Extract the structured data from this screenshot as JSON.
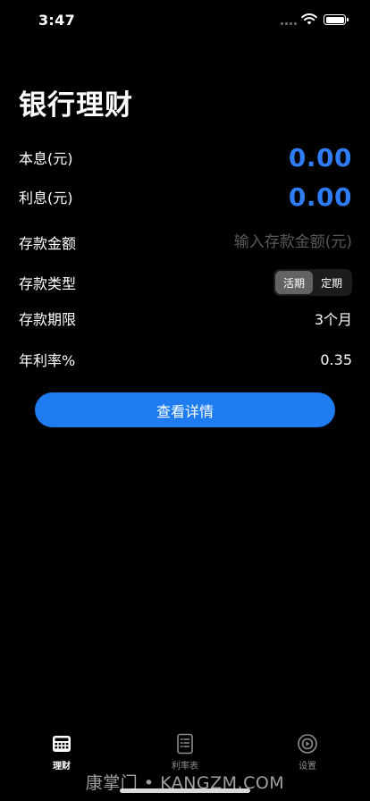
{
  "status": {
    "time": "3:47"
  },
  "title": "银行理财",
  "principal": {
    "label": "本息(元)",
    "value": "0.00"
  },
  "interest": {
    "label": "利息(元)",
    "value": "0.00"
  },
  "amount": {
    "label": "存款金额",
    "placeholder": "输入存款金额(元)",
    "value": ""
  },
  "deposit_type": {
    "label": "存款类型",
    "options": [
      "活期",
      "定期"
    ],
    "selected": "活期"
  },
  "term": {
    "label": "存款期限",
    "value": "3个月"
  },
  "rate": {
    "label": "年利率%",
    "value": "0.35"
  },
  "detail_button": "查看详情",
  "tabs": [
    {
      "label": "理财",
      "icon": "calculator-icon",
      "active": true
    },
    {
      "label": "利率表",
      "icon": "document-list-icon",
      "active": false
    },
    {
      "label": "设置",
      "icon": "settings-icon",
      "active": false
    }
  ],
  "watermark": "康掌门 • KANGZM.COM",
  "colors": {
    "accent": "#2f7df6",
    "button": "#1e7cf0",
    "background": "#000000"
  }
}
